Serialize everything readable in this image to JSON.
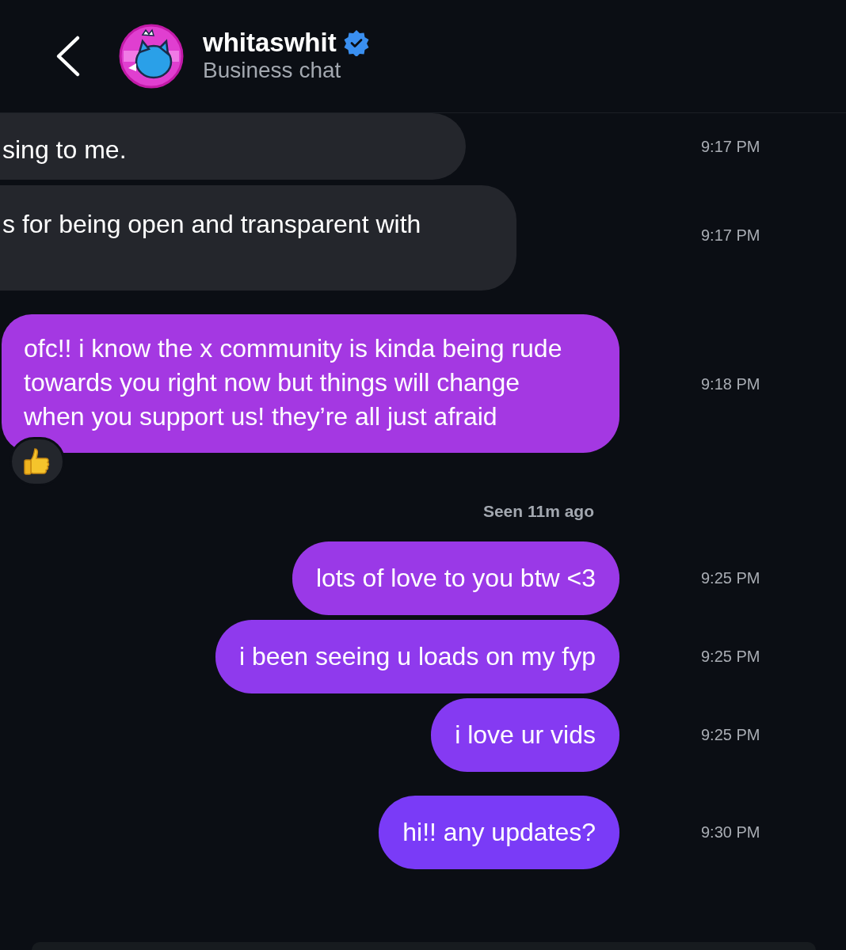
{
  "header": {
    "username": "whitaswhit",
    "verified": true,
    "subtitle": "Business chat"
  },
  "messages": [
    {
      "kind": "received",
      "text": "sing to me.",
      "time": "9:17 PM",
      "reacted": false
    },
    {
      "kind": "received",
      "text": "s for being open and transparent with",
      "time": "9:17 PM",
      "reacted": false
    },
    {
      "kind": "sent",
      "text": "ofc!! i know the x community is kinda being rude towards you right now but things will change when you support us! they’re all just afraid",
      "time": "9:18 PM",
      "reacted": true
    },
    {
      "kind": "seen",
      "text": "Seen 11m ago"
    },
    {
      "kind": "sent",
      "text": "lots of love to you btw <3",
      "time": "9:25 PM",
      "reacted": false
    },
    {
      "kind": "sent",
      "text": "i been seeing u loads on my fyp",
      "time": "9:25 PM",
      "reacted": false
    },
    {
      "kind": "sent",
      "text": "i love ur vids",
      "time": "9:25 PM",
      "reacted": false
    },
    {
      "kind": "sent",
      "text": "hi!! any updates?",
      "time": "9:30 PM",
      "reacted": false
    }
  ]
}
